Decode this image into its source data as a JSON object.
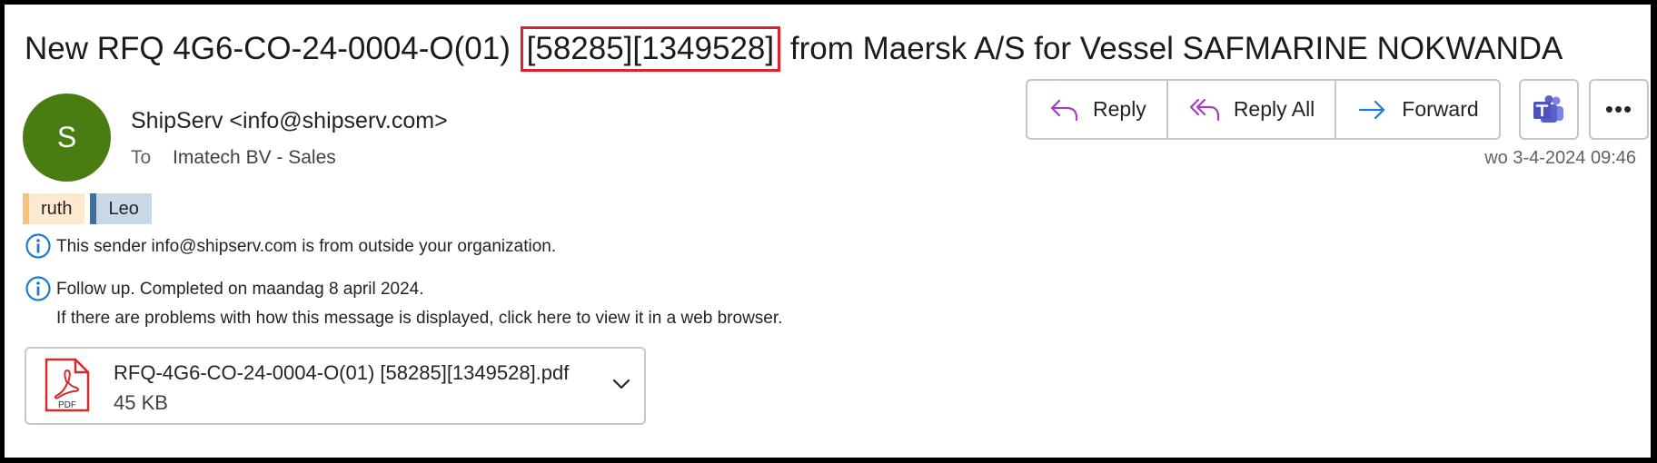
{
  "email": {
    "subject_before": "New RFQ 4G6-CO-24-0004-O(01)",
    "subject_highlight": "[58285][1349528]",
    "subject_after": "from Maersk A/S for Vessel SAFMARINE NOKWANDA",
    "avatar_initial": "S",
    "sender": "ShipServ <info@shipserv.com>",
    "to_label": "To",
    "to_value": "Imatech BV - Sales",
    "timestamp": "wo 3-4-2024 09:46"
  },
  "tags": [
    {
      "label": "ruth",
      "color": "#f5c27a"
    },
    {
      "label": "Leo",
      "color": "#3f6f9c"
    }
  ],
  "infobar": {
    "external_notice": "This sender info@shipserv.com is from outside your organization.",
    "followup": "Follow up.  Completed on maandag 8 april 2024.",
    "display_problem": "If there are problems with how this message is displayed, click here to view it in a web browser."
  },
  "attachment": {
    "filename": "RFQ-4G6-CO-24-0004-O(01) [58285][1349528].pdf",
    "size": "45 KB",
    "icon": "pdf-icon",
    "icon_label": "PDF"
  },
  "actions": {
    "reply": "Reply",
    "reply_all": "Reply All",
    "forward": "Forward",
    "more": "•••"
  },
  "colors": {
    "avatar": "#4a7d11",
    "highlight_border": "#e0202a",
    "reply_icon": "#a33fbf",
    "forward_icon": "#1f7ad1",
    "info_icon": "#1f7ad1",
    "teams": "#5b5fc7"
  }
}
